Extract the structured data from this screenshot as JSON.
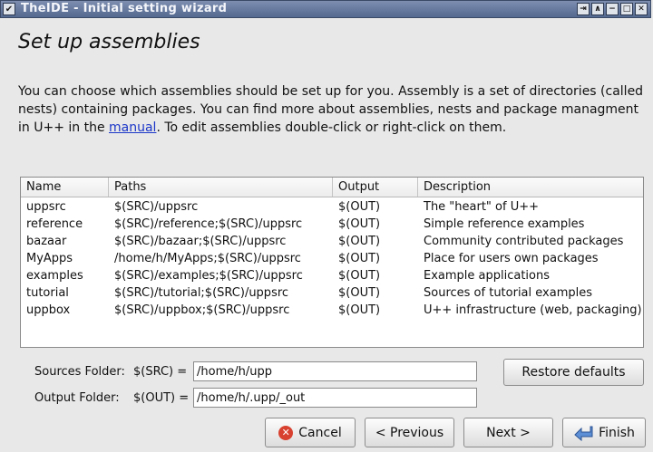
{
  "window": {
    "title": "TheIDE - Initial setting wizard",
    "menu_glyph": "✔",
    "controls": [
      "⇥",
      "∧",
      "−",
      "□",
      "✕"
    ]
  },
  "page": {
    "heading": "Set up assemblies",
    "desc_before_link": "You can choose which assemblies should be set up for you. Assembly is a set of directories (called nests) containing packages. You can find more about assemblies, nests and package managment in U++ in the ",
    "desc_link": "manual",
    "desc_after_link": ". To edit assemblies double-click or right-click on them."
  },
  "table": {
    "columns": [
      "Name",
      "Paths",
      "Output",
      "Description"
    ],
    "rows": [
      {
        "name": "uppsrc",
        "paths": "$(SRC)/uppsrc",
        "output": "$(OUT)",
        "description": "The \"heart\" of U++"
      },
      {
        "name": "reference",
        "paths": "$(SRC)/reference;$(SRC)/uppsrc",
        "output": "$(OUT)",
        "description": "Simple reference examples"
      },
      {
        "name": "bazaar",
        "paths": "$(SRC)/bazaar;$(SRC)/uppsrc",
        "output": "$(OUT)",
        "description": "Community contributed packages"
      },
      {
        "name": "MyApps",
        "paths": "/home/h/MyApps;$(SRC)/uppsrc",
        "output": "$(OUT)",
        "description": "Place for users own packages"
      },
      {
        "name": "examples",
        "paths": "$(SRC)/examples;$(SRC)/uppsrc",
        "output": "$(OUT)",
        "description": "Example applications"
      },
      {
        "name": "tutorial",
        "paths": "$(SRC)/tutorial;$(SRC)/uppsrc",
        "output": "$(OUT)",
        "description": "Sources of tutorial examples"
      },
      {
        "name": "uppbox",
        "paths": "$(SRC)/uppbox;$(SRC)/uppsrc",
        "output": "$(OUT)",
        "description": "U++ infrastructure (web, packaging)"
      }
    ]
  },
  "folders": {
    "sources_label": "Sources Folder:",
    "sources_var": "$(SRC) =",
    "sources_value": "/home/h/upp",
    "output_label": "Output Folder:",
    "output_var": "$(OUT) =",
    "output_value": "/home/h/.upp/_out"
  },
  "buttons": {
    "restore": "Restore defaults",
    "cancel": "Cancel",
    "previous": "< Previous",
    "next": "Next >",
    "finish": "Finish"
  }
}
